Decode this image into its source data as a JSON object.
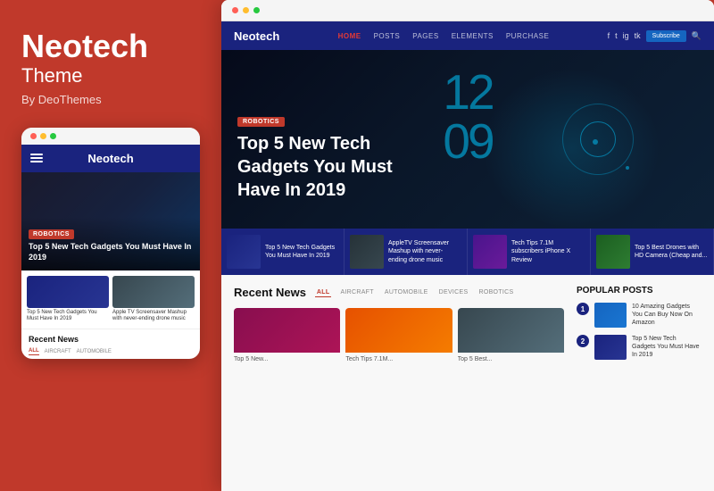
{
  "brand": {
    "title": "Neotech",
    "subtitle": "Theme",
    "by": "By DeoThemes"
  },
  "browser": {
    "nav": {
      "logo": "Neotech",
      "links": [
        "HOME",
        "POSTS",
        "PAGES",
        "ELEMENTS",
        "PURCHASE"
      ],
      "subscribe": "Subscribe"
    },
    "hero": {
      "badge": "ROBOTICS",
      "title": "Top 5 New Tech Gadgets You Must Have In 2019",
      "digits": "12\n09"
    },
    "strip": [
      {
        "text": "Top 5 New Tech Gadgets You Must Have In 2019"
      },
      {
        "text": "AppleTV Screensaver Mashup with never-ending drone music"
      },
      {
        "text": "Tech Tips 7.1M subscribers iPhone X Review"
      },
      {
        "text": "Top 5 Best Drones with HD Camera (Cheap and..."
      }
    ],
    "recent_news": {
      "title": "Recent News",
      "tabs": [
        "ALL",
        "AIRCRAFT",
        "AUTOMOBILE",
        "DEVICES",
        "ROBOTICS"
      ],
      "active_tab": "ALL"
    },
    "popular": {
      "title": "POPULAR POSTS",
      "items": [
        {
          "num": "1",
          "text": "10 Amazing Gadgets You Can Buy Now On Amazon"
        },
        {
          "num": "2",
          "text": "Top 5 New Tech Gadgets You Must Have In 2019"
        }
      ]
    }
  },
  "mobile": {
    "nav_title": "Neotech",
    "hero_badge": "ROBOTICS",
    "hero_title": "Top 5 New Tech Gadgets You Must Have In 2019",
    "thumbs": [
      {
        "label": "Top 5 New Tech Gadgets You Must Have In 2019"
      },
      {
        "label": "Apple TV Screensaver Mashup with never-ending drone music"
      }
    ],
    "recent_title": "Recent News",
    "recent_tabs": [
      "ALL",
      "AIRCRAFT",
      "AUTOMOBILE"
    ]
  }
}
